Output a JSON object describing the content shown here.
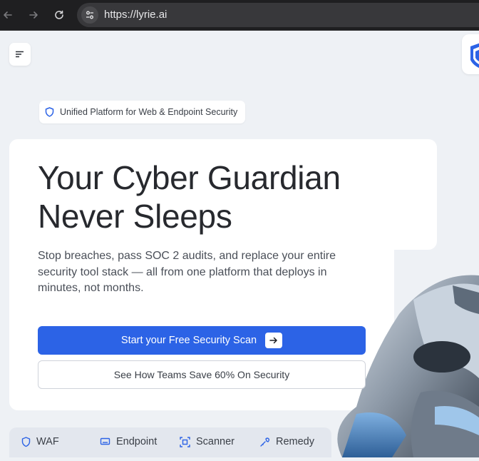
{
  "browser": {
    "url": "https://lyrie.ai"
  },
  "badge": {
    "label": "Unified Platform for Web & Endpoint Security"
  },
  "hero": {
    "title_line1": "Your Cyber Guardian",
    "title_line2": "Never Sleeps",
    "subtitle_line1": "Stop breaches, pass SOC 2 audits, and replace your entire",
    "subtitle_line2": "security tool stack — all from one platform that deploys in",
    "subtitle_line3": "minutes, not months."
  },
  "cta": {
    "primary_label": "Start your Free Security Scan",
    "secondary_label": "See How Teams Save 60% On Security"
  },
  "features": [
    {
      "label": "WAF",
      "icon": "shield-icon"
    },
    {
      "label": "Endpoint",
      "icon": "laptop-icon"
    },
    {
      "label": "Scanner",
      "icon": "scan-icon"
    },
    {
      "label": "Remedy",
      "icon": "wrench-icon"
    }
  ],
  "colors": {
    "accent": "#2c63e6",
    "background": "#eef1f5",
    "text": "#27292e"
  }
}
